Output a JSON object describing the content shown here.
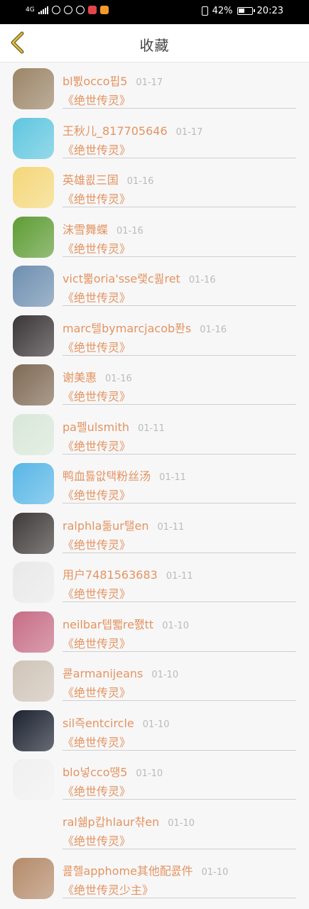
{
  "status": {
    "network": "4G",
    "battery": "42%",
    "time": "20:23"
  },
  "header": {
    "title": "收藏",
    "back_icon": "chevron-left-icon",
    "accent": "#e3c23a"
  },
  "colors": {
    "name": "#e39460",
    "date": "#bbbbbb"
  },
  "favorites": [
    {
      "name": "bl쀬occo핍5",
      "date": "01-17",
      "book": "《绝世传灵》",
      "avatar": "#9b8567"
    },
    {
      "name": "王秋儿_817705646",
      "date": "01-17",
      "book": "《绝世传灵》",
      "avatar": "#5fc6df"
    },
    {
      "name": "英雄쾺三国",
      "date": "01-16",
      "book": "《绝世传灵》",
      "avatar": "#f4d77a"
    },
    {
      "name": "沫雪舞蝶",
      "date": "01-16",
      "book": "《绝世传灵》",
      "avatar": "#5e9c34"
    },
    {
      "name": "vict뿗oria'sse랯c쾶ret",
      "date": "01-16",
      "book": "《绝世传灵》",
      "avatar": "#6e8fb0"
    },
    {
      "name": "marc텔bymarcjacob퐌s",
      "date": "01-16",
      "book": "《绝世传灵》",
      "avatar": "#3a3536"
    },
    {
      "name": "谢美惠",
      "date": "01-16",
      "book": "《绝世传灵》",
      "avatar": "#7f6a55"
    },
    {
      "name": "pa펠ulsmith",
      "date": "01-11",
      "book": "《绝世传灵》",
      "avatar": "#d8e7d8"
    },
    {
      "name": "鸭血틇앖택粉丝汤",
      "date": "01-11",
      "book": "《绝世传灵》",
      "avatar": "#58b6e6"
    },
    {
      "name": "ralphla돎ur탤en",
      "date": "01-11",
      "book": "《绝世传灵》",
      "avatar": "#3f3a38"
    },
    {
      "name": "用户7481563683",
      "date": "01-11",
      "book": "《绝世传灵》",
      "avatar": "#e9e9e9"
    },
    {
      "name": "neilbar텝뾃re쬀tt",
      "date": "01-10",
      "book": "《绝世传灵》",
      "avatar": "#c76d86"
    },
    {
      "name": "쿋armanijeans",
      "date": "01-10",
      "book": "《绝世传灵》",
      "avatar": "#cfc4b8"
    },
    {
      "name": "sil즉entcircle",
      "date": "01-10",
      "book": "《绝世传灵》",
      "avatar": "#1c2230"
    },
    {
      "name": "blo넣cco땡5",
      "date": "01-10",
      "book": "《绝世传灵》",
      "avatar": "#f0f0f0"
    },
    {
      "name": "ral쉚p캅hlaur챢en",
      "date": "01-10",
      "book": "《绝世传灵》",
      "avatar": ""
    },
    {
      "name": "쿒헬apphome其他配쿐件",
      "date": "01-10",
      "book": "《绝世传灵少主》",
      "avatar": "#b48b6a"
    }
  ]
}
